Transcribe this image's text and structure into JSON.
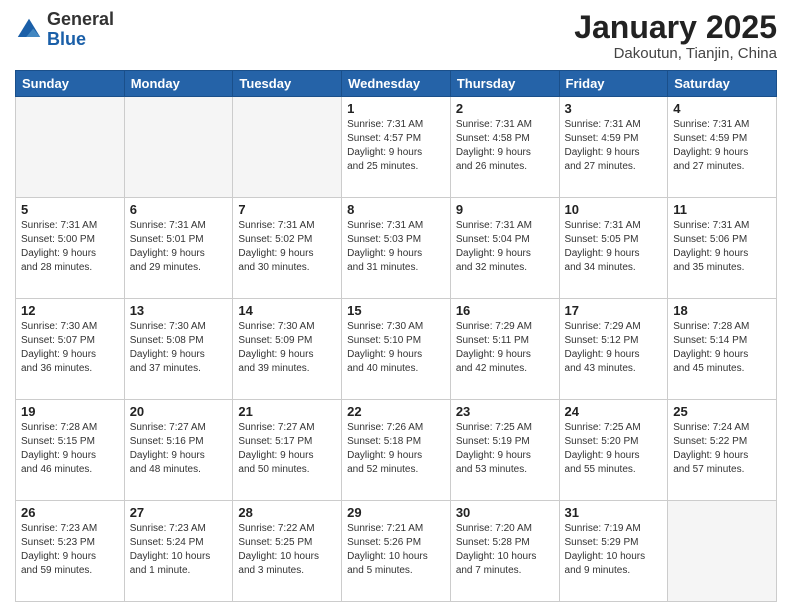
{
  "header": {
    "logo_general": "General",
    "logo_blue": "Blue",
    "title": "January 2025",
    "subtitle": "Dakoutun, Tianjin, China"
  },
  "weekdays": [
    "Sunday",
    "Monday",
    "Tuesday",
    "Wednesday",
    "Thursday",
    "Friday",
    "Saturday"
  ],
  "weeks": [
    [
      {
        "day": "",
        "info": ""
      },
      {
        "day": "",
        "info": ""
      },
      {
        "day": "",
        "info": ""
      },
      {
        "day": "1",
        "info": "Sunrise: 7:31 AM\nSunset: 4:57 PM\nDaylight: 9 hours\nand 25 minutes."
      },
      {
        "day": "2",
        "info": "Sunrise: 7:31 AM\nSunset: 4:58 PM\nDaylight: 9 hours\nand 26 minutes."
      },
      {
        "day": "3",
        "info": "Sunrise: 7:31 AM\nSunset: 4:59 PM\nDaylight: 9 hours\nand 27 minutes."
      },
      {
        "day": "4",
        "info": "Sunrise: 7:31 AM\nSunset: 4:59 PM\nDaylight: 9 hours\nand 27 minutes."
      }
    ],
    [
      {
        "day": "5",
        "info": "Sunrise: 7:31 AM\nSunset: 5:00 PM\nDaylight: 9 hours\nand 28 minutes."
      },
      {
        "day": "6",
        "info": "Sunrise: 7:31 AM\nSunset: 5:01 PM\nDaylight: 9 hours\nand 29 minutes."
      },
      {
        "day": "7",
        "info": "Sunrise: 7:31 AM\nSunset: 5:02 PM\nDaylight: 9 hours\nand 30 minutes."
      },
      {
        "day": "8",
        "info": "Sunrise: 7:31 AM\nSunset: 5:03 PM\nDaylight: 9 hours\nand 31 minutes."
      },
      {
        "day": "9",
        "info": "Sunrise: 7:31 AM\nSunset: 5:04 PM\nDaylight: 9 hours\nand 32 minutes."
      },
      {
        "day": "10",
        "info": "Sunrise: 7:31 AM\nSunset: 5:05 PM\nDaylight: 9 hours\nand 34 minutes."
      },
      {
        "day": "11",
        "info": "Sunrise: 7:31 AM\nSunset: 5:06 PM\nDaylight: 9 hours\nand 35 minutes."
      }
    ],
    [
      {
        "day": "12",
        "info": "Sunrise: 7:30 AM\nSunset: 5:07 PM\nDaylight: 9 hours\nand 36 minutes."
      },
      {
        "day": "13",
        "info": "Sunrise: 7:30 AM\nSunset: 5:08 PM\nDaylight: 9 hours\nand 37 minutes."
      },
      {
        "day": "14",
        "info": "Sunrise: 7:30 AM\nSunset: 5:09 PM\nDaylight: 9 hours\nand 39 minutes."
      },
      {
        "day": "15",
        "info": "Sunrise: 7:30 AM\nSunset: 5:10 PM\nDaylight: 9 hours\nand 40 minutes."
      },
      {
        "day": "16",
        "info": "Sunrise: 7:29 AM\nSunset: 5:11 PM\nDaylight: 9 hours\nand 42 minutes."
      },
      {
        "day": "17",
        "info": "Sunrise: 7:29 AM\nSunset: 5:12 PM\nDaylight: 9 hours\nand 43 minutes."
      },
      {
        "day": "18",
        "info": "Sunrise: 7:28 AM\nSunset: 5:14 PM\nDaylight: 9 hours\nand 45 minutes."
      }
    ],
    [
      {
        "day": "19",
        "info": "Sunrise: 7:28 AM\nSunset: 5:15 PM\nDaylight: 9 hours\nand 46 minutes."
      },
      {
        "day": "20",
        "info": "Sunrise: 7:27 AM\nSunset: 5:16 PM\nDaylight: 9 hours\nand 48 minutes."
      },
      {
        "day": "21",
        "info": "Sunrise: 7:27 AM\nSunset: 5:17 PM\nDaylight: 9 hours\nand 50 minutes."
      },
      {
        "day": "22",
        "info": "Sunrise: 7:26 AM\nSunset: 5:18 PM\nDaylight: 9 hours\nand 52 minutes."
      },
      {
        "day": "23",
        "info": "Sunrise: 7:25 AM\nSunset: 5:19 PM\nDaylight: 9 hours\nand 53 minutes."
      },
      {
        "day": "24",
        "info": "Sunrise: 7:25 AM\nSunset: 5:20 PM\nDaylight: 9 hours\nand 55 minutes."
      },
      {
        "day": "25",
        "info": "Sunrise: 7:24 AM\nSunset: 5:22 PM\nDaylight: 9 hours\nand 57 minutes."
      }
    ],
    [
      {
        "day": "26",
        "info": "Sunrise: 7:23 AM\nSunset: 5:23 PM\nDaylight: 9 hours\nand 59 minutes."
      },
      {
        "day": "27",
        "info": "Sunrise: 7:23 AM\nSunset: 5:24 PM\nDaylight: 10 hours\nand 1 minute."
      },
      {
        "day": "28",
        "info": "Sunrise: 7:22 AM\nSunset: 5:25 PM\nDaylight: 10 hours\nand 3 minutes."
      },
      {
        "day": "29",
        "info": "Sunrise: 7:21 AM\nSunset: 5:26 PM\nDaylight: 10 hours\nand 5 minutes."
      },
      {
        "day": "30",
        "info": "Sunrise: 7:20 AM\nSunset: 5:28 PM\nDaylight: 10 hours\nand 7 minutes."
      },
      {
        "day": "31",
        "info": "Sunrise: 7:19 AM\nSunset: 5:29 PM\nDaylight: 10 hours\nand 9 minutes."
      },
      {
        "day": "",
        "info": ""
      }
    ]
  ]
}
